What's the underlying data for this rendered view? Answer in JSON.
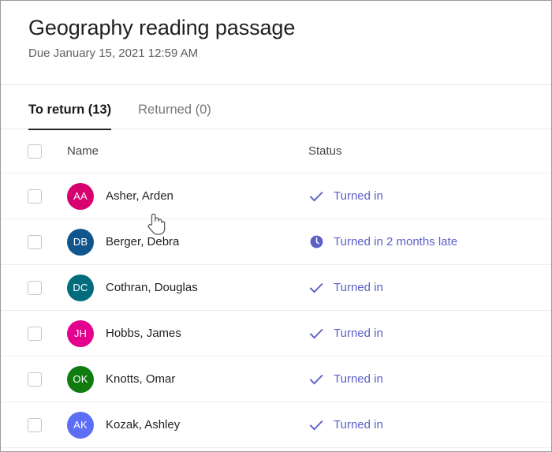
{
  "header": {
    "title": "Geography reading passage",
    "due": "Due January 15, 2021 12:59 AM"
  },
  "tabs": [
    {
      "label": "To return (13)",
      "active": true
    },
    {
      "label": "Returned (0)",
      "active": false
    }
  ],
  "table": {
    "columns": {
      "name": "Name",
      "status": "Status"
    },
    "rows": [
      {
        "initials": "AA",
        "avatar_color": "#D6006E",
        "name": "Asher, Arden",
        "status": "Turned in",
        "status_icon": "check-icon"
      },
      {
        "initials": "DB",
        "avatar_color": "#10558C",
        "name": "Berger, Debra",
        "status": "Turned in 2 months late",
        "status_icon": "clock-icon"
      },
      {
        "initials": "DC",
        "avatar_color": "#026C7C",
        "name": "Cothran, Douglas",
        "status": "Turned in",
        "status_icon": "check-icon"
      },
      {
        "initials": "JH",
        "avatar_color": "#E3008C",
        "name": "Hobbs, James",
        "status": "Turned in",
        "status_icon": "check-icon"
      },
      {
        "initials": "OK",
        "avatar_color": "#107C10",
        "name": "Knotts, Omar",
        "status": "Turned in",
        "status_icon": "check-icon"
      },
      {
        "initials": "AK",
        "avatar_color": "#5B6EF5",
        "name": "Kozak, Ashley",
        "status": "Turned in",
        "status_icon": "check-icon"
      }
    ]
  },
  "colors": {
    "status_accent": "#5b5fc7",
    "tab_active": "#242424",
    "border": "#ededf0"
  },
  "cursor": {
    "type": "hand-pointer"
  }
}
